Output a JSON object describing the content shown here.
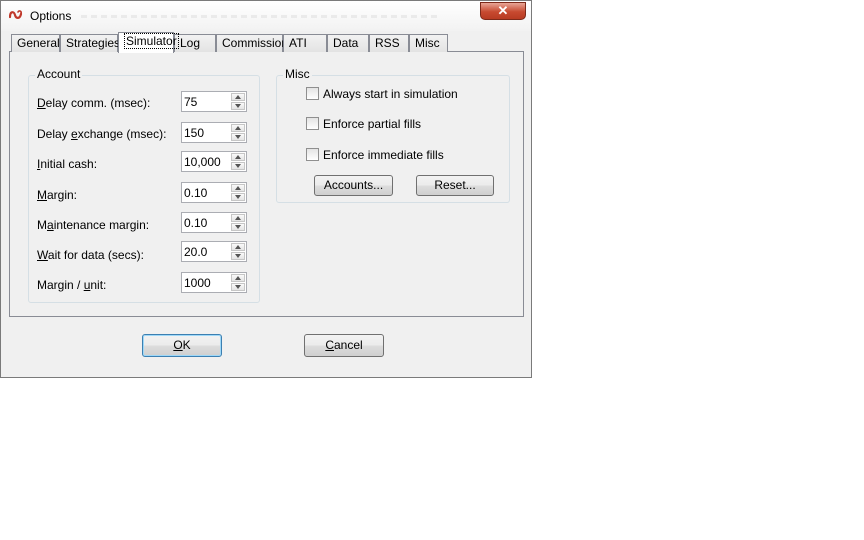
{
  "window": {
    "title": "Options",
    "close_glyph": "✕"
  },
  "tabs": [
    {
      "label": "General"
    },
    {
      "label": "Strategies"
    },
    {
      "label": "Simulator",
      "selected": true
    },
    {
      "label": "Log"
    },
    {
      "label": "Commission"
    },
    {
      "label": "ATI"
    },
    {
      "label": "Data"
    },
    {
      "label": "RSS"
    },
    {
      "label": "Misc"
    }
  ],
  "account": {
    "title": "Account",
    "fields": [
      {
        "label_pre": "",
        "label_u": "D",
        "label_post": "elay comm. (msec):",
        "value": "75"
      },
      {
        "label_pre": "Delay ",
        "label_u": "e",
        "label_post": "xchange (msec):",
        "value": "150"
      },
      {
        "label_pre": "",
        "label_u": "I",
        "label_post": "nitial cash:",
        "value": "10,000"
      },
      {
        "label_pre": "",
        "label_u": "M",
        "label_post": "argin:",
        "value": "0.10"
      },
      {
        "label_pre": "M",
        "label_u": "a",
        "label_post": "intenance margin:",
        "value": "0.10"
      },
      {
        "label_pre": "",
        "label_u": "W",
        "label_post": "ait for data (secs):",
        "value": "20.0"
      },
      {
        "label_pre": "Margin / ",
        "label_u": "u",
        "label_post": "nit:",
        "value": "1000"
      }
    ]
  },
  "misc": {
    "title": "Misc",
    "checkboxes": [
      {
        "label": "Always start in simulation",
        "checked": false
      },
      {
        "label": "Enforce partial fills",
        "checked": false
      },
      {
        "label": "Enforce immediate fills",
        "checked": false
      }
    ],
    "accounts_button": "Accounts...",
    "reset_button": "Reset..."
  },
  "footer": {
    "ok_u": "O",
    "ok_rest": "K",
    "cancel_u": "C",
    "cancel_rest": "ancel"
  },
  "colors": {
    "close_button": "#c74a30",
    "default_button_border": "#3c7fb1"
  }
}
